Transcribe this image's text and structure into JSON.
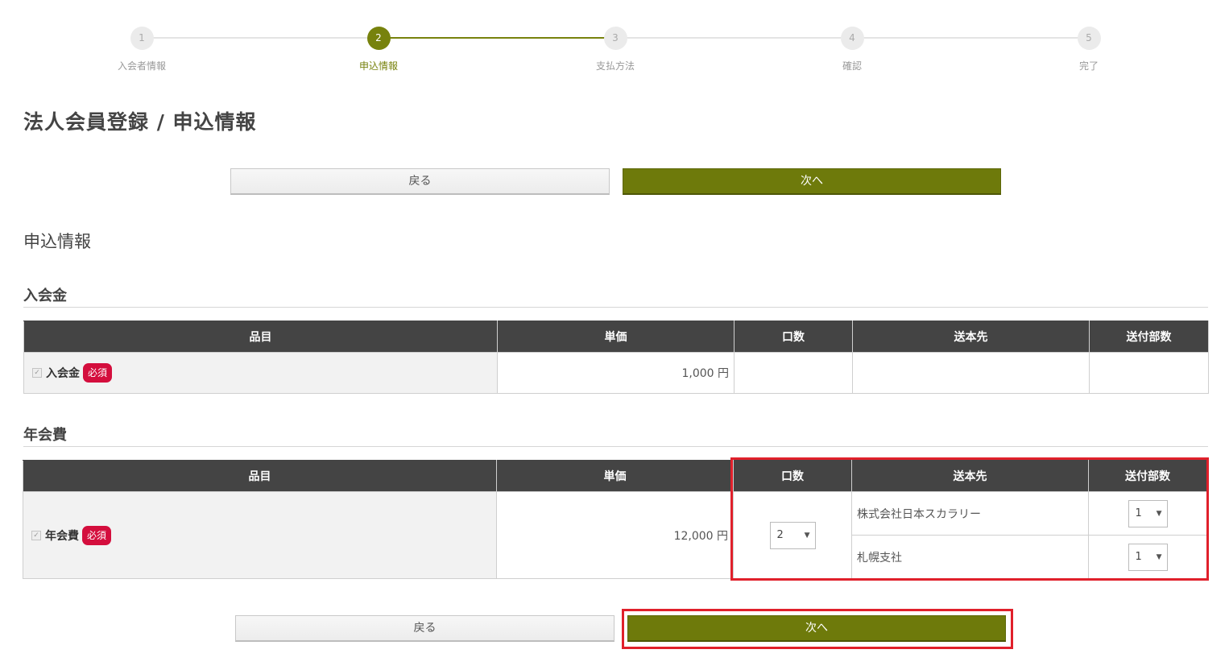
{
  "stepper": {
    "steps": [
      {
        "number": "1",
        "label": "入会者情報"
      },
      {
        "number": "2",
        "label": "申込情報"
      },
      {
        "number": "3",
        "label": "支払方法"
      },
      {
        "number": "4",
        "label": "確認"
      },
      {
        "number": "5",
        "label": "完了"
      }
    ],
    "current": 2
  },
  "page_title": "法人会員登録 / 申込情報",
  "buttons": {
    "back": "戻る",
    "next": "次へ"
  },
  "section_title": "申込情報",
  "colors": {
    "accent": "#6e7a0b",
    "header_bg": "#444444",
    "required_badge": "#d40e3d",
    "highlight": "#e0202b"
  },
  "table_headers": [
    "品目",
    "単価",
    "口数",
    "送本先",
    "送付部数"
  ],
  "entry_fee": {
    "title": "入会金",
    "item": "入会金",
    "badge": "必須",
    "price": "1,000 円"
  },
  "annual_fee": {
    "title": "年会費",
    "item": "年会費",
    "badge": "必須",
    "price": "12,000 円",
    "quantity": "2",
    "destinations": [
      {
        "name": "株式会社日本スカラリー",
        "copies": "1"
      },
      {
        "name": "札幌支社",
        "copies": "1"
      }
    ]
  }
}
